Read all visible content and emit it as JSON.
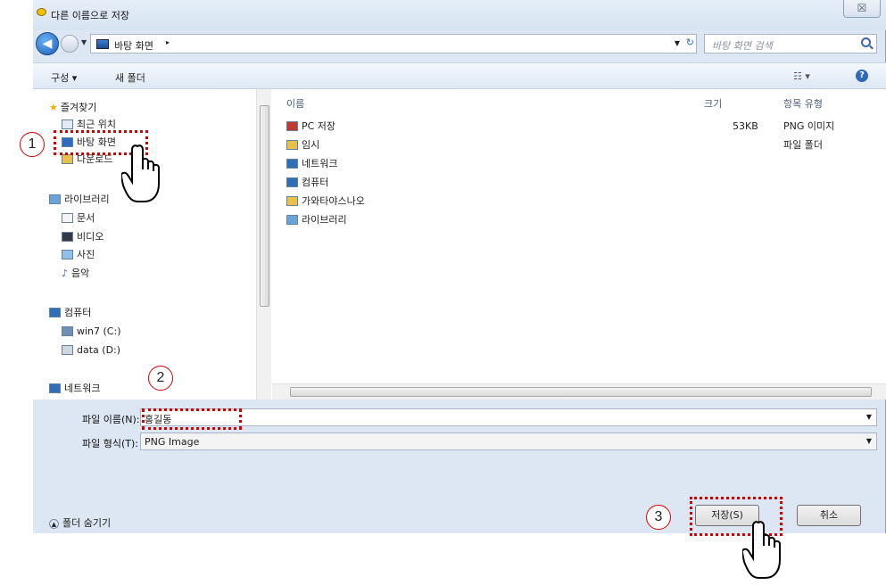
{
  "window": {
    "title": "다른 이름으로 저장",
    "close_glyph": "☒"
  },
  "nav": {
    "back_glyph": "◀",
    "address_path": "바탕 화면",
    "address_arrow": "▸",
    "dropdown_glyph": "▼",
    "refresh_glyph": "↻",
    "search_placeholder": "바탕 화면 검색"
  },
  "toolbar": {
    "organize": "구성 ▾",
    "new_folder": "새 폴더",
    "view": "☷ ▾",
    "help": "?"
  },
  "sidebar": {
    "favorites": "즐겨찾기",
    "recent": "최근 위치",
    "desktop": "바탕 화면",
    "downloads": "다운로드",
    "libraries": "라이브러리",
    "documents": "문서",
    "videos": "비디오",
    "pictures": "사진",
    "music": "음악",
    "computer": "컴퓨터",
    "drive_c": "win7 (C:)",
    "drive_d": "data (D:)",
    "network": "네트워크"
  },
  "columns": {
    "name": "이름",
    "size": "크기",
    "type": "항목 유형"
  },
  "files": [
    {
      "name": "PC 저장",
      "size": "53KB",
      "type": "PNG 이미지",
      "icon": "png-file-icon",
      "color": "#c0392b"
    },
    {
      "name": "임시",
      "size": "",
      "type": "파일 폴더",
      "icon": "folder-icon",
      "color": "#e8c04a"
    },
    {
      "name": "네트워크",
      "size": "",
      "type": "",
      "icon": "network-icon",
      "color": "#2f6fb8"
    },
    {
      "name": "컴퓨터",
      "size": "",
      "type": "",
      "icon": "computer-icon",
      "color": "#2f6fb8"
    },
    {
      "name": "가와타야스나오",
      "size": "",
      "type": "",
      "icon": "user-folder-icon",
      "color": "#e8c04a"
    },
    {
      "name": "라이브러리",
      "size": "",
      "type": "",
      "icon": "library-icon",
      "color": "#6aa3d8"
    }
  ],
  "form": {
    "filename_label": "파일 이름(N):",
    "filename_value": "홍길동",
    "filetype_label": "파일 형식(T):",
    "filetype_value": "PNG Image",
    "dropdown_glyph": "▼"
  },
  "footer": {
    "hide_folders": "폴더 숨기기",
    "save": "저장(S)",
    "cancel": "취소"
  },
  "annotations": {
    "step1": "1",
    "step2": "2",
    "step3": "3"
  },
  "colors": {
    "highlight": "#d40000",
    "dialog_bg": "#dce7f3"
  }
}
